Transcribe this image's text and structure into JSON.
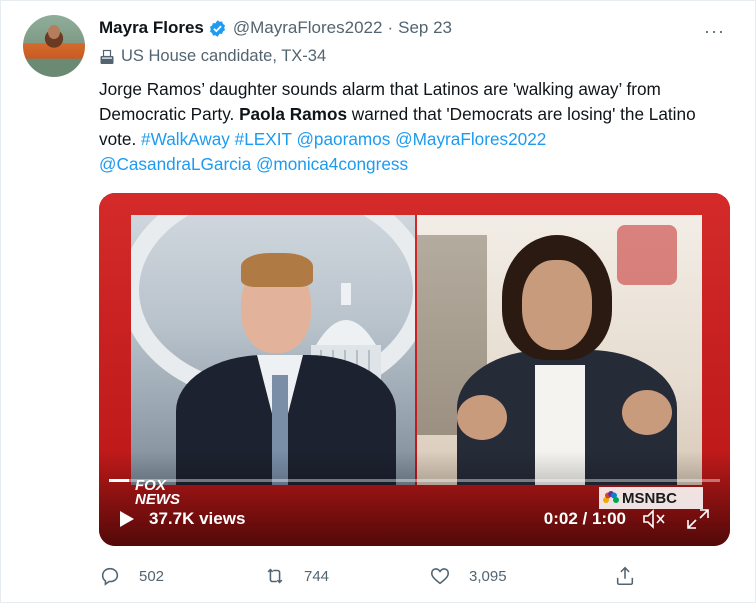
{
  "author": {
    "name": "Mayra Flores",
    "handle": "@MayraFlores2022",
    "separator": "·",
    "date": "Sep 23",
    "label": "US House candidate, TX-34"
  },
  "more_menu": "···",
  "tweet": {
    "text_part1": "Jorge Ramos’ daughter sounds alarm that Latinos are 'walking away’ from Democratic Party. ",
    "bold_name": "Paola Ramos",
    "text_part2": " warned that 'Democrats are losing' the Latino vote.  ",
    "links": [
      "#WalkAway",
      "#LEXIT",
      "@paoramos",
      "@MayraFlores2022",
      "@CasandraLGarcia",
      "@monica4congress"
    ]
  },
  "video": {
    "views": "37.7K views",
    "time": "0:02 / 1:00",
    "progress": 0.033,
    "left_logo": "FOX NEWS",
    "right_logo": "MSNBC"
  },
  "actions": {
    "replies": "502",
    "retweets": "744",
    "likes": "3,095"
  },
  "colors": {
    "link": "#1d9bf0",
    "muted": "#536471",
    "verified": "#1d9bf0",
    "video_border": "#c51a1a"
  }
}
